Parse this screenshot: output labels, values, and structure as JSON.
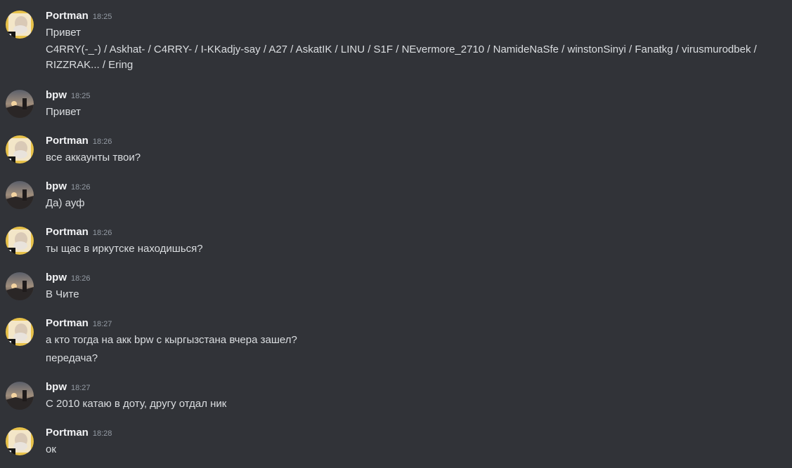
{
  "messages": [
    {
      "author": "Portman",
      "time": "18:25",
      "avatar": "portman-avatar",
      "lines": [
        "Привет",
        "C4RRY(-_-) / Askhat- / C4RRY- / I-KKadjy-say / A27 / AskatIK / LINU / S1F / NEvermore_2710 / NamideNaSfe / winstonSinyi / Fanatkg / virusmurodbek / RIZZRAK... / Ering"
      ]
    },
    {
      "author": "bpw",
      "time": "18:25",
      "avatar": "bpw-avatar",
      "lines": [
        "Привет"
      ]
    },
    {
      "author": "Portman",
      "time": "18:26",
      "avatar": "portman-avatar",
      "lines": [
        "все аккаунты твои?"
      ]
    },
    {
      "author": "bpw",
      "time": "18:26",
      "avatar": "bpw-avatar",
      "lines": [
        "Да) ауф"
      ]
    },
    {
      "author": "Portman",
      "time": "18:26",
      "avatar": "portman-avatar",
      "lines": [
        "ты щас в иркутске находишься?"
      ]
    },
    {
      "author": "bpw",
      "time": "18:26",
      "avatar": "bpw-avatar",
      "lines": [
        "В Чите"
      ]
    },
    {
      "author": "Portman",
      "time": "18:27",
      "avatar": "portman-avatar",
      "lines": [
        "а кто тогда на акк bpw с кыргызстана вчера зашел?",
        "передача?"
      ]
    },
    {
      "author": "bpw",
      "time": "18:27",
      "avatar": "bpw-avatar",
      "lines": [
        "С 2010 катаю в доту, другу отдал ник"
      ]
    },
    {
      "author": "Portman",
      "time": "18:28",
      "avatar": "portman-avatar",
      "lines": [
        "ок"
      ]
    }
  ],
  "colors": {
    "background": "#313338",
    "author": "#f2f3f5",
    "timestamp": "#949ba4",
    "text": "#dbdee1"
  }
}
